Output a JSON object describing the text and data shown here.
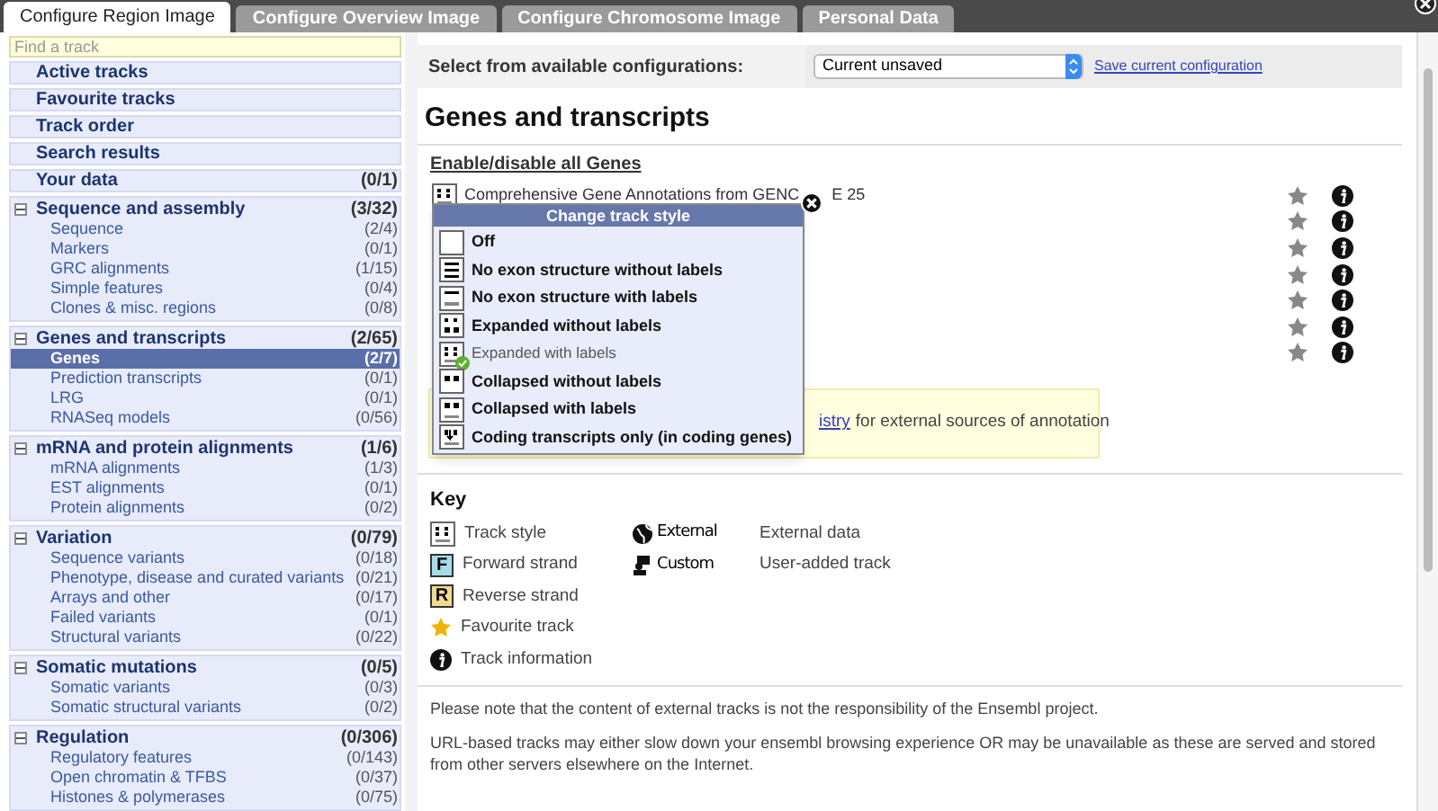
{
  "tabs": [
    {
      "label": "Configure Region Image",
      "selected": true
    },
    {
      "label": "Configure Overview Image",
      "selected": false
    },
    {
      "label": "Configure Chromosome Image",
      "selected": false
    },
    {
      "label": "Personal Data",
      "selected": false
    }
  ],
  "sidebar": {
    "search": {
      "placeholder": "Find a track"
    },
    "links": [
      {
        "label": "Active tracks"
      },
      {
        "label": "Favourite tracks"
      },
      {
        "label": "Track order"
      },
      {
        "label": "Search results"
      },
      {
        "label": "Your data",
        "count": "(0/1)"
      }
    ],
    "groups": [
      {
        "label": "Sequence and assembly",
        "count": "(3/32)",
        "expanded": true,
        "children": [
          {
            "label": "Sequence",
            "count": "(2/4)",
            "selected": false
          },
          {
            "label": "Markers",
            "count": "(0/1)",
            "selected": false
          },
          {
            "label": "GRC alignments",
            "count": "(1/15)",
            "selected": false
          },
          {
            "label": "Simple features",
            "count": "(0/4)",
            "selected": false
          },
          {
            "label": "Clones & misc. regions",
            "count": "(0/8)",
            "selected": false
          }
        ]
      },
      {
        "label": "Genes and transcripts",
        "count": "(2/65)",
        "expanded": true,
        "children": [
          {
            "label": "Genes",
            "count": "(2/7)",
            "selected": true
          },
          {
            "label": "Prediction transcripts",
            "count": "(0/1)",
            "selected": false
          },
          {
            "label": "LRG",
            "count": "(0/1)",
            "selected": false
          },
          {
            "label": "RNASeq models",
            "count": "(0/56)",
            "selected": false
          }
        ]
      },
      {
        "label": "mRNA and protein alignments",
        "count": "(1/6)",
        "expanded": true,
        "children": [
          {
            "label": "mRNA alignments",
            "count": "(1/3)",
            "selected": false
          },
          {
            "label": "EST alignments",
            "count": "(0/1)",
            "selected": false
          },
          {
            "label": "Protein alignments",
            "count": "(0/2)",
            "selected": false
          }
        ]
      },
      {
        "label": "Variation",
        "count": "(0/79)",
        "expanded": true,
        "children": [
          {
            "label": "Sequence variants",
            "count": "(0/18)",
            "selected": false
          },
          {
            "label": "Phenotype, disease and curated variants",
            "count": "(0/21)",
            "selected": false
          },
          {
            "label": "Arrays and other",
            "count": "(0/17)",
            "selected": false
          },
          {
            "label": "Failed variants",
            "count": "(0/1)",
            "selected": false
          },
          {
            "label": "Structural variants",
            "count": "(0/22)",
            "selected": false
          }
        ]
      },
      {
        "label": "Somatic mutations",
        "count": "(0/5)",
        "expanded": true,
        "children": [
          {
            "label": "Somatic variants",
            "count": "(0/3)",
            "selected": false
          },
          {
            "label": "Somatic structural variants",
            "count": "(0/2)",
            "selected": false
          }
        ]
      },
      {
        "label": "Regulation",
        "count": "(0/306)",
        "expanded": true,
        "children": [
          {
            "label": "Regulatory features",
            "count": "(0/143)",
            "selected": false
          },
          {
            "label": "Open chromatin & TFBS",
            "count": "(0/37)",
            "selected": false
          },
          {
            "label": "Histones & polymerases",
            "count": "(0/75)",
            "selected": false
          }
        ]
      }
    ]
  },
  "config_bar": {
    "label": "Select from available configurations:",
    "select_value": "Current unsaved",
    "link": "Save current configuration"
  },
  "section_title": "Genes and transcripts",
  "enable_all": "Enable/disable all Genes",
  "tracks": [
    {
      "name": "Comprehensive Gene Annotations from GENC",
      "name_rest": "E 25",
      "favourite": false
    },
    {
      "favourite": false
    },
    {
      "favourite": false
    },
    {
      "favourite": false
    },
    {
      "favourite": false
    },
    {
      "favourite": false
    },
    {
      "favourite": false
    }
  ],
  "notice": {
    "link": "istry",
    "text": "for external sources of annotation"
  },
  "popup": {
    "title": "Change track style",
    "options": [
      {
        "kind": "off",
        "label": "Off",
        "selected": false
      },
      {
        "kind": "noexon",
        "label": "No exon structure without labels",
        "selected": false
      },
      {
        "kind": "noexon_labels",
        "label": "No exon structure with labels",
        "selected": false
      },
      {
        "kind": "expanded",
        "label": "Expanded without labels",
        "selected": false
      },
      {
        "kind": "expanded_labels",
        "label": "Expanded with labels",
        "selected": true
      },
      {
        "kind": "collapsed",
        "label": "Collapsed without labels",
        "selected": false
      },
      {
        "kind": "collapsed_labels",
        "label": "Collapsed with labels",
        "selected": false
      },
      {
        "kind": "coding",
        "label": "Coding transcripts only (in coding genes)",
        "selected": false
      }
    ]
  },
  "key": {
    "title": "Key",
    "columns": [
      [
        {
          "kind": "style",
          "label": "Track style"
        },
        {
          "kind": "forward",
          "badge": "F",
          "label": "Forward strand"
        },
        {
          "kind": "reverse",
          "badge": "R",
          "label": "Reverse strand"
        },
        {
          "kind": "favourite",
          "label": "Favourite track"
        },
        {
          "kind": "info",
          "label": "Track information"
        }
      ],
      [
        {
          "kind": "external",
          "badge": "External",
          "label": "External data"
        },
        {
          "kind": "custom",
          "badge": "Custom",
          "label": "User-added track"
        }
      ]
    ]
  },
  "notes": [
    "Please note that the content of external tracks is not the responsibility of the Ensembl project.",
    "URL-based tracks may either slow down your ensembl browsing experience OR may be unavailable as these are served and stored from other servers elsewhere on the Internet."
  ]
}
